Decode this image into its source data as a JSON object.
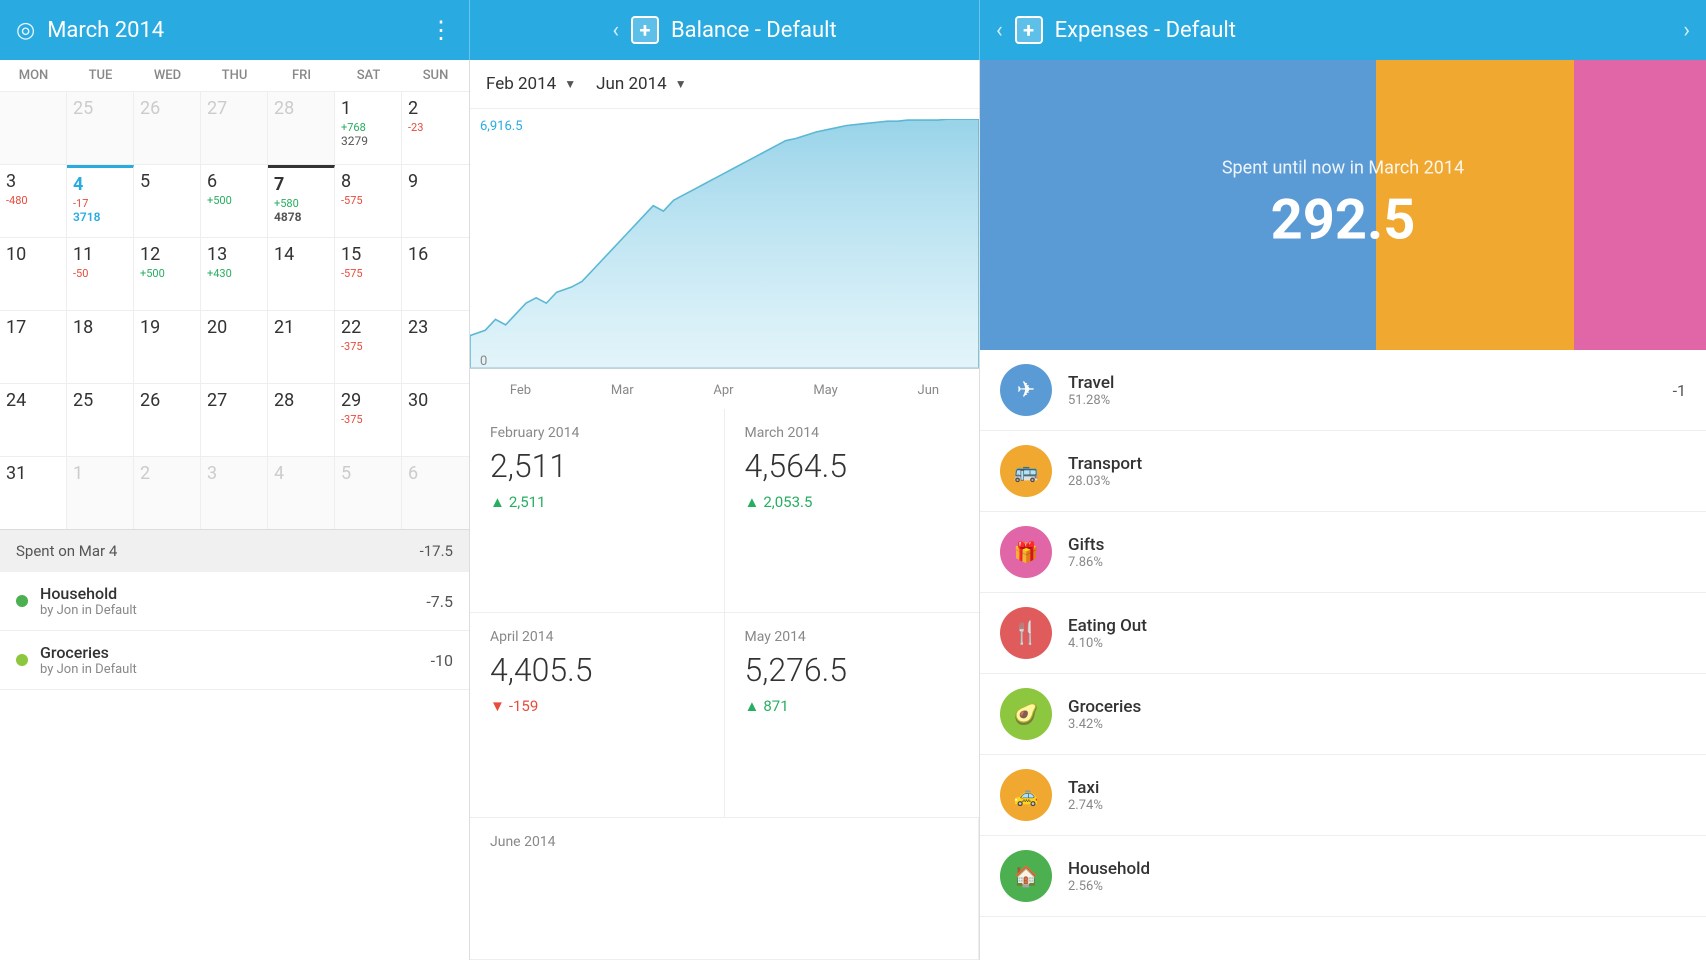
{
  "header": {
    "calendar_title": "March 2014",
    "balance_title": "Balance - Default",
    "expenses_title": "Expenses - Default",
    "menu_icon": "⋮",
    "nav_left": "‹",
    "nav_right": "›",
    "add_icon": "+"
  },
  "calendar": {
    "day_headers": [
      "MON",
      "TUE",
      "WED",
      "THU",
      "FRI",
      "SAT",
      "SUN"
    ],
    "weeks": [
      [
        {
          "date": "",
          "other": true
        },
        {
          "date": "25",
          "other": true
        },
        {
          "date": "26",
          "other": true
        },
        {
          "date": "27",
          "other": true
        },
        {
          "date": "28",
          "other": true
        },
        {
          "date": "1",
          "amount_pos": "+768",
          "balance": "3279"
        },
        {
          "date": "2",
          "amount_neg": "-23"
        }
      ],
      [
        {
          "date": "3",
          "amount_neg": "-480"
        },
        {
          "date": "4",
          "today": true,
          "amount_neg": "-17",
          "balance": "3718"
        },
        {
          "date": "5"
        },
        {
          "date": "6",
          "amount_pos": "+500"
        },
        {
          "date": "7",
          "selected": true,
          "amount_pos": "+580",
          "balance": "4878"
        },
        {
          "date": "8",
          "amount_neg": "-575"
        },
        {
          "date": "9"
        }
      ],
      [
        {
          "date": "10"
        },
        {
          "date": "11",
          "amount_neg": "-50"
        },
        {
          "date": "12",
          "amount_pos": "+500"
        },
        {
          "date": "13",
          "amount_pos": "+430"
        },
        {
          "date": "14"
        },
        {
          "date": "15",
          "amount_neg": "-575"
        },
        {
          "date": "16"
        }
      ],
      [
        {
          "date": "17"
        },
        {
          "date": "18"
        },
        {
          "date": "19"
        },
        {
          "date": "20"
        },
        {
          "date": "21"
        },
        {
          "date": "22",
          "amount_neg": "-375"
        },
        {
          "date": "23"
        }
      ],
      [
        {
          "date": "24"
        },
        {
          "date": "25"
        },
        {
          "date": "26"
        },
        {
          "date": "27"
        },
        {
          "date": "28"
        },
        {
          "date": "29",
          "amount_neg": "-375"
        },
        {
          "date": "30"
        }
      ],
      [
        {
          "date": "31"
        },
        {
          "date": "1",
          "other": true
        },
        {
          "date": "2",
          "other": true
        },
        {
          "date": "3",
          "other": true
        },
        {
          "date": "4",
          "other": true
        },
        {
          "date": "5",
          "other": true
        },
        {
          "date": "6",
          "other": true
        }
      ]
    ]
  },
  "spent_summary": {
    "label": "Spent on Mar 4",
    "amount": "-17.5"
  },
  "transactions": [
    {
      "name": "Household",
      "sub": "by Jon in Default",
      "amount": "-7.5",
      "color": "#4caf50"
    },
    {
      "name": "Groceries",
      "sub": "by Jon in Default",
      "amount": "-10",
      "color": "#8dc63f"
    }
  ],
  "chart": {
    "range_start": "Feb 2014",
    "range_end": "Jun 2014",
    "y_max": "6,916.5",
    "y_min": "0",
    "x_labels": [
      "Feb",
      "Mar",
      "Apr",
      "May",
      "Jun"
    ]
  },
  "monthly_summaries": [
    {
      "month": "February 2014",
      "amount": "2,511",
      "change": "+2,511",
      "positive": true
    },
    {
      "month": "March 2014",
      "amount": "4,564.5",
      "change": "+2,053.5",
      "positive": true
    },
    {
      "month": "April 2014",
      "amount": "4,405.5",
      "change": "-159",
      "positive": false
    },
    {
      "month": "May 2014",
      "amount": "5,276.5",
      "change": "+871",
      "positive": true
    },
    {
      "month": "June 2014",
      "amount": "",
      "change": "",
      "positive": true
    }
  ],
  "expenses_header": {
    "subtitle": "Spent until now in March 2014",
    "total": "292.5"
  },
  "categories": [
    {
      "name": "Travel",
      "pct": "51.28%",
      "icon": "✈",
      "color_class": "cat-travel",
      "amount": "-1"
    },
    {
      "name": "Transport",
      "pct": "28.03%",
      "icon": "🚌",
      "color_class": "cat-transport",
      "amount": ""
    },
    {
      "name": "Gifts",
      "pct": "7.86%",
      "icon": "🎁",
      "color_class": "cat-gifts",
      "amount": ""
    },
    {
      "name": "Eating Out",
      "pct": "4.10%",
      "icon": "🍴",
      "color_class": "cat-eating",
      "amount": "-"
    },
    {
      "name": "Groceries",
      "pct": "3.42%",
      "icon": "🥑",
      "color_class": "cat-groceries",
      "amount": ""
    },
    {
      "name": "Taxi",
      "pct": "2.74%",
      "icon": "🚕",
      "color_class": "cat-taxi",
      "amount": ""
    },
    {
      "name": "Household",
      "pct": "2.56%",
      "icon": "🏠",
      "color_class": "cat-household",
      "amount": ""
    }
  ]
}
